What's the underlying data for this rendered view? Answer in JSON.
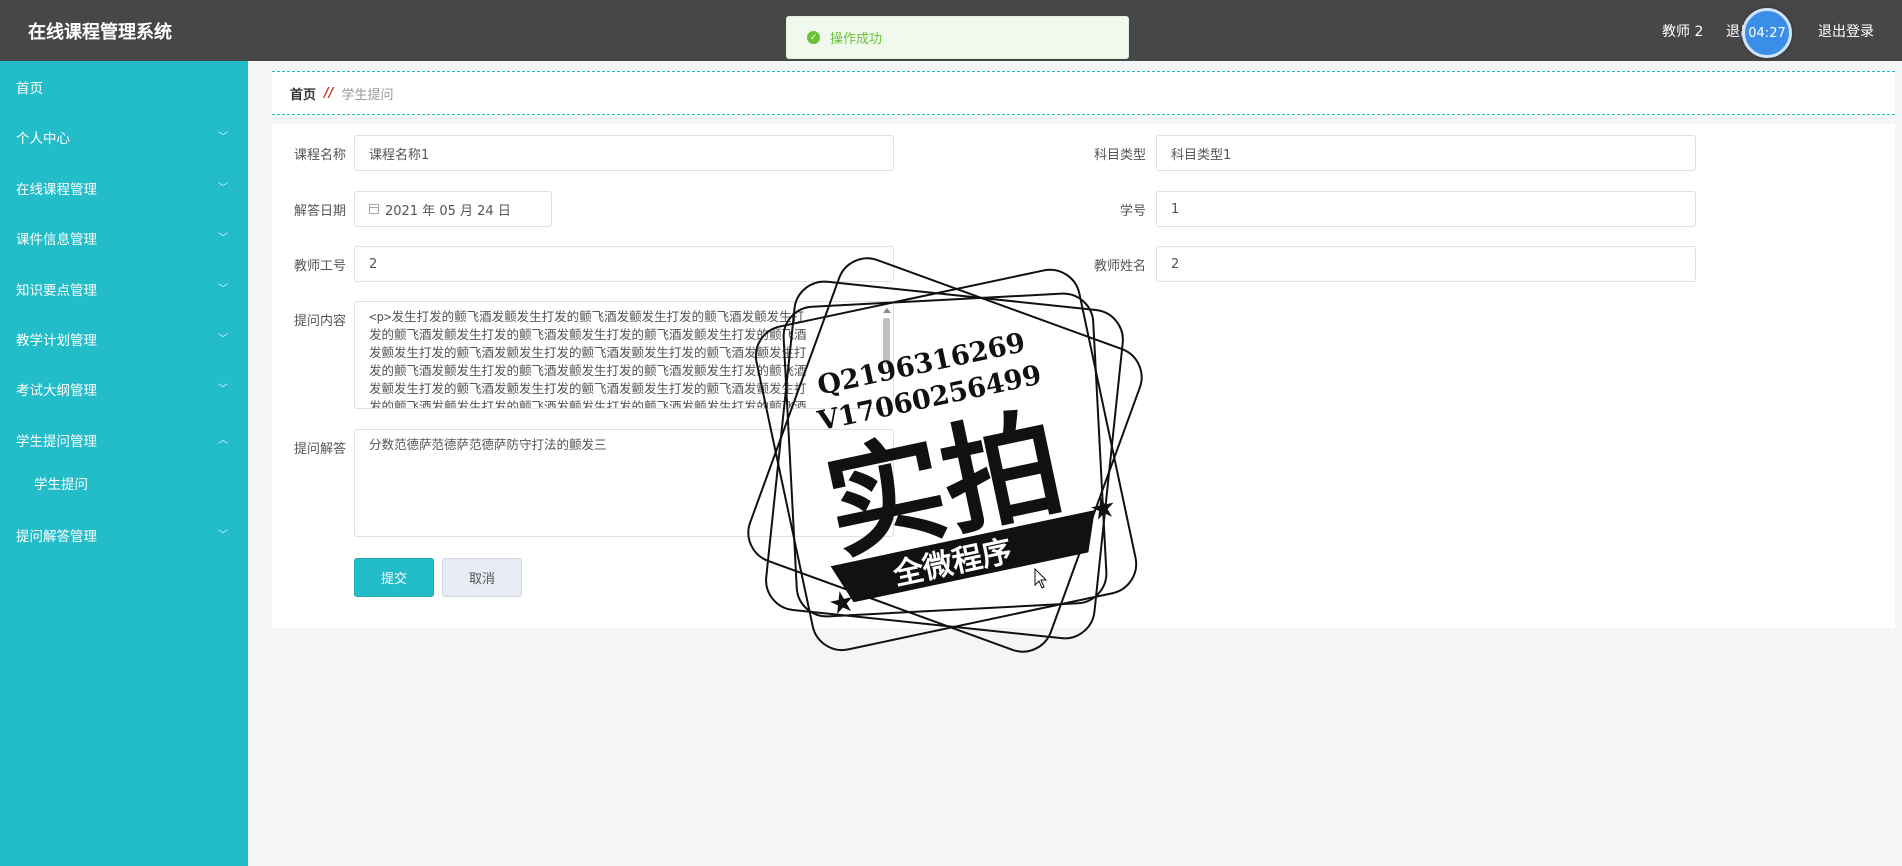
{
  "header": {
    "app_title": "在线课程管理系统",
    "user_name": "教师 2",
    "exit_system": "退出系统",
    "timer": "04:27",
    "logout": "退出登录"
  },
  "toast": {
    "message": "操作成功"
  },
  "sidebar": {
    "items": [
      {
        "label": "首页"
      },
      {
        "label": "个人中心"
      },
      {
        "label": "在线课程管理"
      },
      {
        "label": "课件信息管理"
      },
      {
        "label": "知识要点管理"
      },
      {
        "label": "教学计划管理"
      },
      {
        "label": "考试大纲管理"
      },
      {
        "label": "学生提问管理"
      },
      {
        "label": "学生提问"
      },
      {
        "label": "提问解答管理"
      }
    ]
  },
  "breadcrumb": {
    "home": "首页",
    "sep": "//",
    "current": "学生提问"
  },
  "form": {
    "course_name": {
      "label": "课程名称",
      "value": "课程名称1"
    },
    "subject_type": {
      "label": "科目类型",
      "value": "科目类型1"
    },
    "answer_date": {
      "label": "解答日期",
      "value": "2021 年 05 月 24 日"
    },
    "student_no": {
      "label": "学号",
      "value": "1"
    },
    "teacher_id": {
      "label": "教师工号",
      "value": "2"
    },
    "teacher_name": {
      "label": "教师姓名",
      "value": "2"
    },
    "question_content": {
      "label": "提问内容",
      "lines": [
        "<p>发生打发的颤飞酒发颤发生打发的颤飞酒发颤发生打发的颤飞酒发颤发生打",
        "发的颤飞酒发颤发生打发的颤飞酒发颤发生打发的颤飞酒发颤发生打发的颤飞酒",
        "发颤发生打发的颤飞酒发颤发生打发的颤飞酒发颤发生打发的颤飞酒发颤发生打",
        "发的颤飞酒发颤发生打发的颤飞酒发颤发生打发的颤飞酒发颤发生打发的颤飞酒",
        "发颤发生打发的颤飞酒发颤发生打发的颤飞酒发颤发生打发的颤飞酒发颤发生打",
        "发的颤飞酒发颤发生打发的颤飞酒发颤发生打发的颤飞酒发颤发生打发的颤飞酒"
      ]
    },
    "question_answer": {
      "label": "提问解答",
      "value": "分数范德萨范德萨范德萨防守打法的颤发三"
    },
    "submit_label": "提交",
    "cancel_label": "取消"
  },
  "watermark": {
    "contact_q": "Q2196316269",
    "contact_v": "V17060256499",
    "big_text": "实拍",
    "banner_text": "全微程序"
  },
  "colors": {
    "header_bg": "#474747",
    "sidebar_bg": "#22bdc9",
    "accent": "#22bdc9",
    "toast_bg": "#f0f9eb",
    "toast_text": "#67c23a"
  }
}
